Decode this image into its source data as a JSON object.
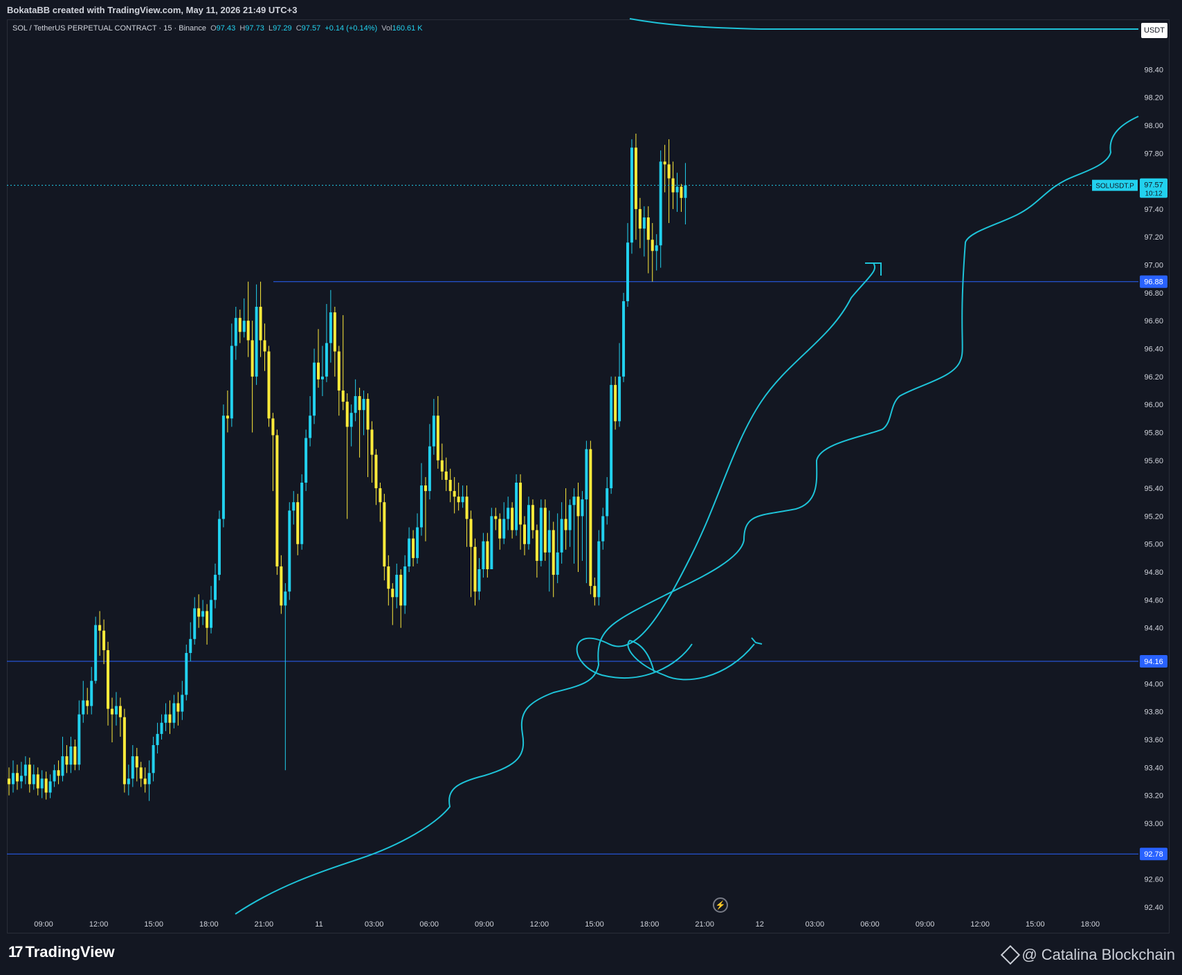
{
  "header": {
    "credit": "BokataBB created with TradingView.com, May 11, 2026 21:49 UTC+3"
  },
  "legend": {
    "symbol": "SOL / TetherUS PERPETUAL CONTRACT · 15 · Binance",
    "o_label": "O",
    "o": "97.43",
    "h_label": "H",
    "h": "97.73",
    "l_label": "L",
    "l": "97.29",
    "c_label": "C",
    "c": "97.57",
    "change": "+0.14 (+0.14%)",
    "vol_label": "Vol",
    "vol": "160.61 K"
  },
  "price_axis": {
    "currency": "USDT"
  },
  "footer": {
    "brand": "TradingView",
    "watermark": "@ Catalina Blockchain"
  },
  "colors": {
    "background": "#131722",
    "up": "#22d1ee",
    "down": "#ffeb3b",
    "hline": "#2962ff",
    "drawing": "#1ec3d8",
    "text": "#d1d4dc"
  },
  "icons": {
    "brand": "tradingview-logo-icon",
    "watermark": "binance-square-icon",
    "replay": "lightning-icon"
  },
  "chart_data": {
    "type": "candlestick",
    "symbol": "SOLUSDT.P",
    "interval": "15",
    "ylim": [
      92.3,
      98.6
    ],
    "y_ticks": [
      92.4,
      92.6,
      93.0,
      93.2,
      93.4,
      93.6,
      93.8,
      94.0,
      94.4,
      94.6,
      94.8,
      95.0,
      95.2,
      95.4,
      95.6,
      95.8,
      96.0,
      96.2,
      96.4,
      96.6,
      96.8,
      97.0,
      97.2,
      97.4,
      97.8,
      98.0,
      98.2,
      98.4
    ],
    "x_ticks": [
      "09:00",
      "12:00",
      "15:00",
      "18:00",
      "21:00",
      "11",
      "03:00",
      "06:00",
      "09:00",
      "12:00",
      "15:00",
      "18:00",
      "21:00",
      "12",
      "03:00",
      "06:00",
      "09:00",
      "12:00",
      "15:00",
      "18:00"
    ],
    "horizontal_levels": [
      96.88,
      94.16,
      92.78
    ],
    "last_price": {
      "label": "SOLUSDT.P",
      "value": "97.57",
      "countdown": "10:12"
    },
    "grid": false,
    "candles": [
      [
        93.32,
        93.28,
        93.4,
        93.2
      ],
      [
        93.28,
        93.36,
        93.45,
        93.22
      ],
      [
        93.36,
        93.3,
        93.42,
        93.24
      ],
      [
        93.3,
        93.34,
        93.44,
        93.25
      ],
      [
        93.34,
        93.42,
        93.48,
        93.28
      ],
      [
        93.42,
        93.28,
        93.47,
        93.22
      ],
      [
        93.28,
        93.35,
        93.42,
        93.24
      ],
      [
        93.35,
        93.25,
        93.4,
        93.2
      ],
      [
        93.25,
        93.32,
        93.38,
        93.18
      ],
      [
        93.32,
        93.22,
        93.37,
        93.17
      ],
      [
        93.22,
        93.3,
        93.35,
        93.18
      ],
      [
        93.3,
        93.38,
        93.42,
        93.26
      ],
      [
        93.38,
        93.34,
        93.45,
        93.28
      ],
      [
        93.34,
        93.48,
        93.62,
        93.3
      ],
      [
        93.48,
        93.42,
        93.56,
        93.36
      ],
      [
        93.42,
        93.55,
        93.62,
        93.36
      ],
      [
        93.55,
        93.42,
        93.6,
        93.38
      ],
      [
        93.42,
        93.78,
        93.88,
        93.38
      ],
      [
        93.78,
        93.88,
        94.02,
        93.72
      ],
      [
        93.88,
        93.84,
        93.97,
        93.78
      ],
      [
        93.84,
        94.02,
        94.12,
        93.78
      ],
      [
        94.02,
        94.42,
        94.48,
        94.0
      ],
      [
        94.42,
        94.38,
        94.52,
        94.2
      ],
      [
        94.38,
        94.24,
        94.46,
        94.14
      ],
      [
        94.24,
        93.82,
        94.3,
        93.7
      ],
      [
        93.82,
        93.78,
        93.9,
        93.58
      ],
      [
        93.78,
        93.84,
        93.94,
        93.7
      ],
      [
        93.84,
        93.76,
        93.9,
        93.62
      ],
      [
        93.76,
        93.28,
        93.82,
        93.22
      ],
      [
        93.28,
        93.32,
        93.42,
        93.2
      ],
      [
        93.32,
        93.48,
        93.56,
        93.26
      ],
      [
        93.48,
        93.4,
        93.54,
        93.3
      ],
      [
        93.4,
        93.32,
        93.44,
        93.26
      ],
      [
        93.32,
        93.28,
        93.4,
        93.22
      ],
      [
        93.28,
        93.36,
        93.45,
        93.16
      ],
      [
        93.36,
        93.56,
        93.62,
        93.3
      ],
      [
        93.56,
        93.64,
        93.72,
        93.5
      ],
      [
        93.64,
        93.72,
        93.78,
        93.6
      ],
      [
        93.72,
        93.78,
        93.86,
        93.66
      ],
      [
        93.78,
        93.72,
        93.88,
        93.64
      ],
      [
        93.72,
        93.86,
        93.92,
        93.68
      ],
      [
        93.86,
        93.8,
        93.94,
        93.7
      ],
      [
        93.8,
        93.92,
        94.02,
        93.74
      ],
      [
        93.92,
        94.22,
        94.28,
        93.88
      ],
      [
        94.22,
        94.32,
        94.44,
        94.16
      ],
      [
        94.32,
        94.54,
        94.62,
        94.28
      ],
      [
        94.54,
        94.48,
        94.64,
        94.4
      ],
      [
        94.48,
        94.52,
        94.6,
        94.42
      ],
      [
        94.52,
        94.4,
        94.57,
        94.28
      ],
      [
        94.4,
        94.6,
        94.7,
        94.36
      ],
      [
        94.6,
        94.78,
        94.86,
        94.54
      ],
      [
        94.78,
        95.18,
        95.24,
        94.74
      ],
      [
        95.18,
        95.92,
        96.0,
        95.12
      ],
      [
        95.92,
        95.9,
        96.1,
        95.8
      ],
      [
        95.9,
        96.42,
        96.58,
        95.84
      ],
      [
        96.42,
        96.62,
        96.7,
        96.32
      ],
      [
        96.62,
        96.52,
        96.68,
        96.44
      ],
      [
        96.52,
        96.6,
        96.76,
        96.48
      ],
      [
        96.6,
        96.46,
        96.88,
        96.34
      ],
      [
        96.46,
        96.2,
        96.6,
        95.8
      ],
      [
        96.2,
        96.7,
        96.86,
        96.14
      ],
      [
        96.7,
        96.46,
        96.88,
        96.34
      ],
      [
        96.46,
        96.38,
        96.58,
        96.24
      ],
      [
        96.38,
        95.9,
        96.42,
        95.84
      ],
      [
        95.9,
        95.78,
        95.94,
        95.38
      ],
      [
        95.78,
        94.84,
        95.82,
        94.78
      ],
      [
        94.84,
        94.56,
        94.92,
        94.5
      ],
      [
        94.56,
        94.66,
        94.72,
        93.38
      ],
      [
        94.66,
        95.24,
        95.3,
        94.6
      ],
      [
        95.24,
        95.3,
        95.38,
        95.14
      ],
      [
        95.3,
        95.0,
        95.36,
        94.92
      ],
      [
        95.0,
        95.44,
        95.5,
        94.96
      ],
      [
        95.44,
        95.76,
        95.82,
        95.38
      ],
      [
        95.76,
        95.92,
        96.06,
        95.7
      ],
      [
        95.92,
        96.3,
        96.4,
        95.86
      ],
      [
        96.3,
        96.18,
        96.54,
        96.12
      ],
      [
        96.18,
        96.2,
        96.42,
        96.06
      ],
      [
        96.2,
        96.44,
        96.72,
        96.16
      ],
      [
        96.44,
        96.66,
        96.82,
        96.3
      ],
      [
        96.66,
        96.38,
        96.7,
        96.2
      ],
      [
        96.38,
        96.1,
        96.42,
        95.92
      ],
      [
        96.1,
        96.02,
        96.64,
        95.96
      ],
      [
        96.02,
        95.84,
        96.08,
        95.18
      ],
      [
        95.84,
        95.94,
        96.0,
        95.7
      ],
      [
        95.94,
        96.06,
        96.18,
        95.88
      ],
      [
        96.06,
        95.96,
        96.12,
        95.62
      ],
      [
        95.96,
        96.04,
        96.1,
        95.78
      ],
      [
        96.04,
        95.82,
        96.08,
        95.48
      ],
      [
        95.82,
        95.64,
        95.88,
        95.44
      ],
      [
        95.64,
        95.4,
        95.68,
        95.28
      ],
      [
        95.4,
        95.3,
        95.44,
        95.16
      ],
      [
        95.3,
        94.84,
        95.36,
        94.74
      ],
      [
        94.84,
        94.68,
        94.92,
        94.56
      ],
      [
        94.68,
        94.62,
        94.72,
        94.42
      ],
      [
        94.62,
        94.78,
        94.86,
        94.54
      ],
      [
        94.78,
        94.56,
        94.82,
        94.4
      ],
      [
        94.56,
        94.84,
        94.92,
        94.5
      ],
      [
        94.84,
        95.04,
        95.12,
        94.8
      ],
      [
        95.04,
        94.9,
        95.1,
        94.84
      ],
      [
        94.9,
        95.12,
        95.22,
        94.86
      ],
      [
        95.12,
        95.42,
        95.58,
        95.06
      ],
      [
        95.42,
        95.38,
        95.48,
        95.02
      ],
      [
        95.38,
        95.7,
        95.86,
        95.32
      ],
      [
        95.7,
        95.92,
        96.04,
        95.64
      ],
      [
        95.92,
        95.6,
        96.06,
        95.54
      ],
      [
        95.6,
        95.52,
        95.72,
        95.46
      ],
      [
        95.52,
        95.46,
        95.62,
        95.38
      ],
      [
        95.46,
        95.38,
        95.54,
        95.3
      ],
      [
        95.38,
        95.34,
        95.48,
        95.22
      ],
      [
        95.34,
        95.3,
        95.44,
        95.24
      ],
      [
        95.3,
        95.34,
        95.42,
        95.26
      ],
      [
        95.34,
        95.18,
        95.42,
        94.98
      ],
      [
        95.18,
        94.98,
        95.24,
        94.62
      ],
      [
        94.98,
        94.66,
        95.04,
        94.56
      ],
      [
        94.66,
        94.82,
        94.9,
        94.6
      ],
      [
        94.82,
        95.02,
        95.08,
        94.76
      ],
      [
        95.02,
        94.82,
        95.08,
        94.76
      ],
      [
        94.82,
        95.2,
        95.26,
        94.86
      ],
      [
        95.2,
        95.18,
        95.26,
        95.1
      ],
      [
        95.18,
        95.04,
        95.22,
        94.96
      ],
      [
        95.04,
        95.18,
        95.3,
        95.0
      ],
      [
        95.18,
        95.26,
        95.34,
        95.1
      ],
      [
        95.26,
        95.1,
        95.3,
        95.04
      ],
      [
        95.1,
        95.44,
        95.5,
        95.06
      ],
      [
        95.44,
        95.14,
        95.5,
        94.96
      ],
      [
        95.14,
        95.0,
        95.2,
        94.92
      ],
      [
        95.0,
        95.28,
        95.34,
        94.96
      ],
      [
        95.28,
        95.1,
        95.32,
        95.04
      ],
      [
        95.1,
        94.88,
        95.14,
        94.76
      ],
      [
        94.88,
        95.26,
        95.32,
        94.84
      ],
      [
        95.26,
        94.94,
        95.32,
        94.88
      ],
      [
        94.94,
        95.1,
        95.24,
        94.66
      ],
      [
        95.1,
        94.78,
        95.16,
        94.62
      ],
      [
        94.78,
        94.94,
        95.22,
        94.72
      ],
      [
        94.94,
        95.18,
        95.3,
        94.86
      ],
      [
        95.18,
        95.1,
        95.4,
        94.96
      ],
      [
        95.1,
        95.28,
        95.32,
        94.98
      ],
      [
        95.28,
        95.34,
        95.4,
        94.86
      ],
      [
        95.34,
        95.2,
        95.44,
        94.8
      ],
      [
        95.2,
        95.32,
        95.38,
        94.88
      ],
      [
        95.32,
        95.68,
        95.74,
        94.72
      ],
      [
        95.68,
        94.7,
        95.74,
        94.64
      ],
      [
        94.7,
        94.62,
        94.76,
        94.56
      ],
      [
        94.62,
        95.02,
        95.1,
        94.56
      ],
      [
        95.02,
        95.2,
        95.26,
        94.96
      ],
      [
        95.2,
        95.4,
        95.48,
        95.14
      ],
      [
        95.4,
        96.14,
        96.2,
        95.36
      ],
      [
        96.14,
        95.88,
        96.2,
        95.82
      ],
      [
        95.88,
        96.2,
        96.44,
        95.84
      ],
      [
        96.2,
        96.74,
        96.8,
        96.16
      ],
      [
        96.74,
        97.16,
        97.3,
        96.7
      ],
      [
        97.16,
        97.84,
        97.9,
        97.08
      ],
      [
        97.84,
        97.4,
        97.94,
        97.18
      ],
      [
        97.4,
        97.26,
        97.48,
        97.12
      ],
      [
        97.26,
        97.34,
        97.42,
        97.06
      ],
      [
        97.34,
        97.18,
        97.42,
        96.94
      ],
      [
        97.18,
        97.1,
        97.3,
        96.88
      ],
      [
        97.1,
        97.14,
        97.22,
        96.96
      ],
      [
        97.14,
        97.74,
        97.82,
        96.98
      ],
      [
        97.74,
        97.72,
        97.86,
        97.52
      ],
      [
        97.72,
        97.62,
        97.9,
        97.3
      ],
      [
        97.62,
        97.52,
        97.74,
        97.4
      ],
      [
        97.52,
        97.56,
        97.66,
        97.38
      ],
      [
        97.56,
        97.48,
        97.58,
        97.38
      ],
      [
        97.48,
        97.57,
        97.73,
        97.29
      ]
    ]
  }
}
